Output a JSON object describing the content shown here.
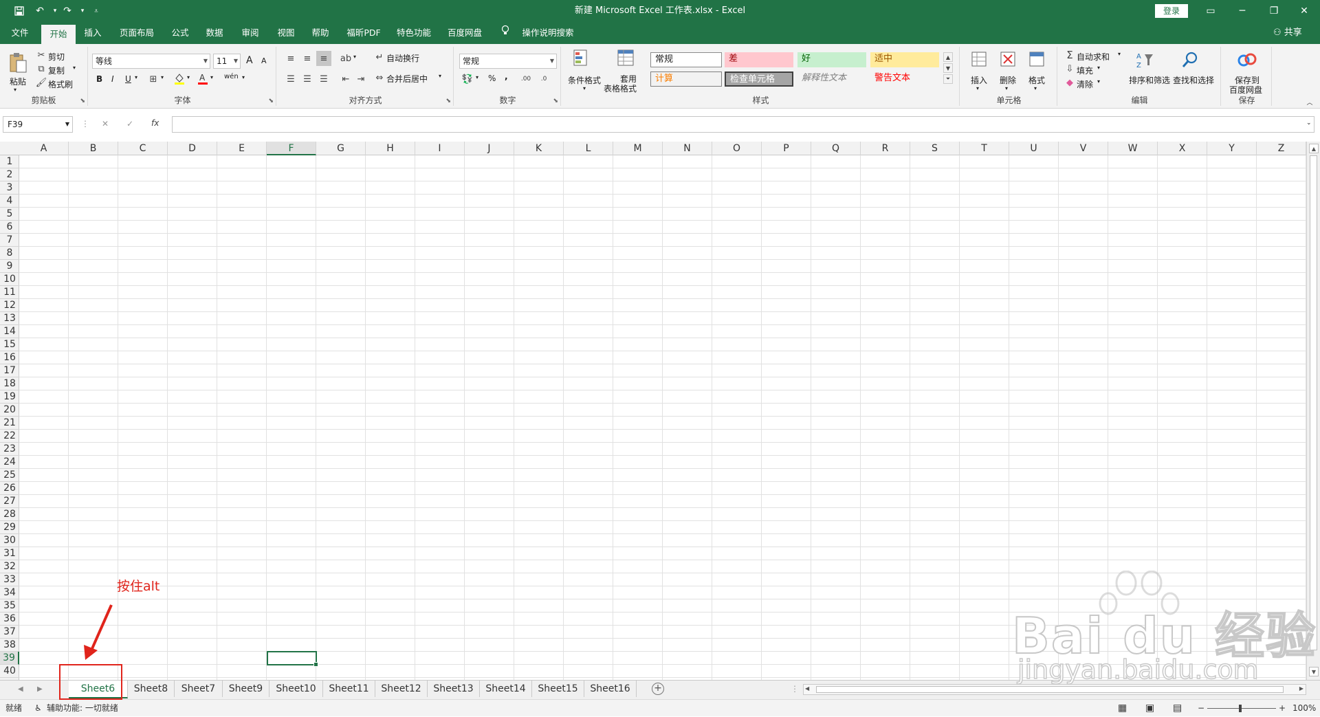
{
  "window": {
    "title": "新建 Microsoft Excel 工作表.xlsx  -  Excel",
    "login": "登录",
    "share": "共享"
  },
  "ribbon_tabs": [
    "文件",
    "开始",
    "插入",
    "页面布局",
    "公式",
    "数据",
    "审阅",
    "视图",
    "帮助",
    "福昕PDF",
    "特色功能",
    "百度网盘",
    "操作说明搜索"
  ],
  "active_tab": "开始",
  "clipboard": {
    "paste": "粘贴",
    "cut": "剪切",
    "copy": "复制",
    "format_painter": "格式刷",
    "label": "剪贴板"
  },
  "font": {
    "name": "等线",
    "size": "11",
    "label": "字体",
    "bold": "B",
    "italic": "I",
    "underline": "U",
    "grow": "A",
    "shrink": "A",
    "color": "A",
    "phonetic": "wén"
  },
  "alignment": {
    "wrap": "自动换行",
    "merge": "合并后居中",
    "label": "对齐方式"
  },
  "number": {
    "format": "常规",
    "percent": "%",
    "comma": ",",
    "label": "数字"
  },
  "styles": {
    "conditional": "条件格式",
    "table_line1": "套用",
    "table_line2": "表格格式",
    "normal": "常规",
    "bad": "差",
    "good": "好",
    "neutral": "适中",
    "calc": "计算",
    "check_cell": "检查单元格",
    "explanatory": "解释性文本",
    "warning": "警告文本",
    "label": "样式"
  },
  "cells_group": {
    "insert": "插入",
    "delete": "删除",
    "format": "格式",
    "label": "单元格"
  },
  "editing": {
    "autosum": "自动求和",
    "fill": "填充",
    "clear": "清除",
    "sort": "排序和筛选",
    "find": "查找和选择",
    "label": "编辑"
  },
  "save_group": {
    "line1": "保存到",
    "line2": "百度网盘",
    "label": "保存"
  },
  "formula_bar": {
    "name_box": "F39",
    "fx": "fx",
    "cancel": "✕",
    "enter": "✓",
    "value": ""
  },
  "columns": [
    "A",
    "B",
    "C",
    "D",
    "E",
    "F",
    "G",
    "H",
    "I",
    "J",
    "K",
    "L",
    "M",
    "N",
    "O",
    "P",
    "Q",
    "R",
    "S",
    "T",
    "U",
    "V",
    "W",
    "X",
    "Y",
    "Z"
  ],
  "selected_column": "F",
  "selected_row": "39",
  "rows": [
    "1",
    "2",
    "3",
    "4",
    "5",
    "6",
    "7",
    "8",
    "9",
    "10",
    "11",
    "12",
    "13",
    "14",
    "15",
    "16",
    "17",
    "18",
    "19",
    "20",
    "21",
    "22",
    "23",
    "24",
    "25",
    "26",
    "27",
    "28",
    "29",
    "30",
    "31",
    "32",
    "33",
    "34",
    "35",
    "36",
    "37",
    "38",
    "39",
    "40"
  ],
  "sheets": [
    "Sheet6",
    "Sheet8",
    "Sheet7",
    "Sheet9",
    "Sheet10",
    "Sheet11",
    "Sheet12",
    "Sheet13",
    "Sheet14",
    "Sheet15",
    "Sheet16"
  ],
  "active_sheet": "Sheet6",
  "status": {
    "ready": "就绪",
    "accessibility": "辅助功能: 一切就绪",
    "zoom": "100%"
  },
  "annotation": {
    "text": "按住alt"
  },
  "watermark": {
    "brand": "Bai du 经验",
    "url": "jingyan.baidu.com"
  },
  "colors": {
    "excel_green": "#217346",
    "annotation_red": "#e0241b"
  }
}
